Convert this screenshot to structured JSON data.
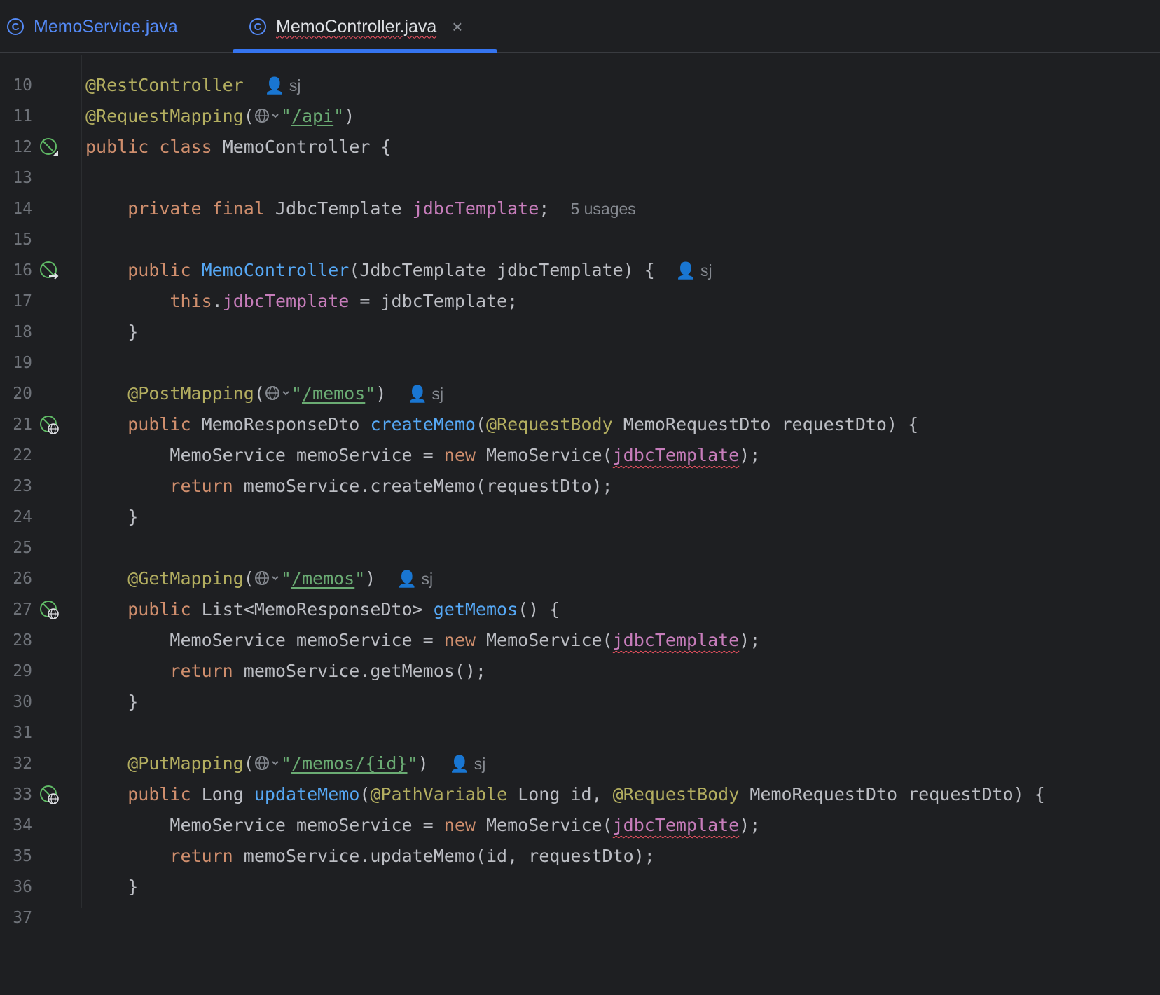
{
  "tabs": [
    {
      "label": "MemoService.java",
      "icon": "class-icon"
    },
    {
      "label": "MemoController.java",
      "icon": "class-icon",
      "active": true,
      "close": "×"
    }
  ],
  "colors": {
    "keyword": "#cf8e6d",
    "annotation": "#b3ae60",
    "function": "#56a8f5",
    "field": "#c77dbb",
    "string": "#6aab73",
    "accent": "#3574f0"
  },
  "editor": {
    "lines": [
      {
        "n": "10"
      },
      {
        "n": "11",
        "t": {
          "a1": "@RestController",
          "author": "sj"
        }
      },
      {
        "n": "12",
        "t": {
          "a1": "@RequestMapping",
          "p1": "(",
          "q1": "\"",
          "u1": "/api",
          "q2": "\"",
          "p2": ")"
        }
      },
      {
        "n": "13",
        "t": {
          "k1": "public",
          "k2": "class",
          "c1": "MemoController {"
        }
      },
      {
        "n": "14"
      },
      {
        "n": "15",
        "t": {
          "k1": "private",
          "k2": "final",
          "c1": "JdbcTemplate",
          "f1": "jdbcTemplate",
          "c2": ";",
          "usages": "5 usages"
        }
      },
      {
        "n": "16"
      },
      {
        "n": "17",
        "t": {
          "k1": "public",
          "fn1": "MemoController",
          "c1": "(JdbcTemplate jdbcTemplate) {",
          "author": "sj"
        }
      },
      {
        "n": "18",
        "t": {
          "k1": "this",
          "c1": ".",
          "f1": "jdbcTemplate",
          "c2": " = jdbcTemplate;"
        }
      },
      {
        "n": "19",
        "t": {
          "c1": "}"
        }
      },
      {
        "n": "20"
      },
      {
        "n": "21",
        "t": {
          "a1": "@PostMapping",
          "p1": "(",
          "q1": "\"",
          "u1": "/memos",
          "q2": "\"",
          "p2": ")",
          "author": "sj"
        }
      },
      {
        "n": "22",
        "t": {
          "k1": "public",
          "c1": "MemoResponseDto",
          "fn1": "createMemo",
          "c2": "(",
          "a1": "@RequestBody",
          "c3": "MemoRequestDto requestDto) {"
        }
      },
      {
        "n": "23",
        "t": {
          "c1": "MemoService memoService = ",
          "k1": "new",
          "c2": "MemoService(",
          "f1": "jdbcTemplate",
          "c3": ");"
        }
      },
      {
        "n": "24",
        "t": {
          "k1": "return",
          "c1": "memoService.createMemo(requestDto);"
        }
      },
      {
        "n": "25",
        "t": {
          "c1": "}"
        }
      },
      {
        "n": "26"
      },
      {
        "n": "27",
        "t": {
          "a1": "@GetMapping",
          "p1": "(",
          "q1": "\"",
          "u1": "/memos",
          "q2": "\"",
          "p2": ")",
          "author": "sj"
        }
      },
      {
        "n": "28",
        "t": {
          "k1": "public",
          "c1": "List<MemoResponseDto>",
          "fn1": "getMemos",
          "c2": "() {"
        }
      },
      {
        "n": "29",
        "t": {
          "c1": "MemoService memoService = ",
          "k1": "new",
          "c2": "MemoService(",
          "f1": "jdbcTemplate",
          "c3": ");"
        }
      },
      {
        "n": "30",
        "t": {
          "k1": "return",
          "c1": "memoService.getMemos();"
        }
      },
      {
        "n": "31",
        "t": {
          "c1": "}"
        }
      },
      {
        "n": "32"
      },
      {
        "n": "33",
        "t": {
          "a1": "@PutMapping",
          "p1": "(",
          "q1": "\"",
          "u1": "/memos/{id}",
          "q2": "\"",
          "p2": ")",
          "author": "sj"
        }
      },
      {
        "n": "34",
        "t": {
          "k1": "public",
          "c1": "Long",
          "fn1": "updateMemo",
          "c2": "(",
          "a1": "@PathVariable",
          "c3": "Long id, ",
          "a2": "@RequestBody",
          "c4": "MemoRequestDto requestDto) {"
        }
      },
      {
        "n": "35",
        "t": {
          "c1": "MemoService memoService = ",
          "k1": "new",
          "c2": "MemoService(",
          "f1": "jdbcTemplate",
          "c3": ");"
        }
      },
      {
        "n": "36",
        "t": {
          "k1": "return",
          "c1": "memoService.updateMemo(id, requestDto);"
        }
      },
      {
        "n": "37",
        "t": {
          "c1": "}"
        }
      }
    ]
  }
}
